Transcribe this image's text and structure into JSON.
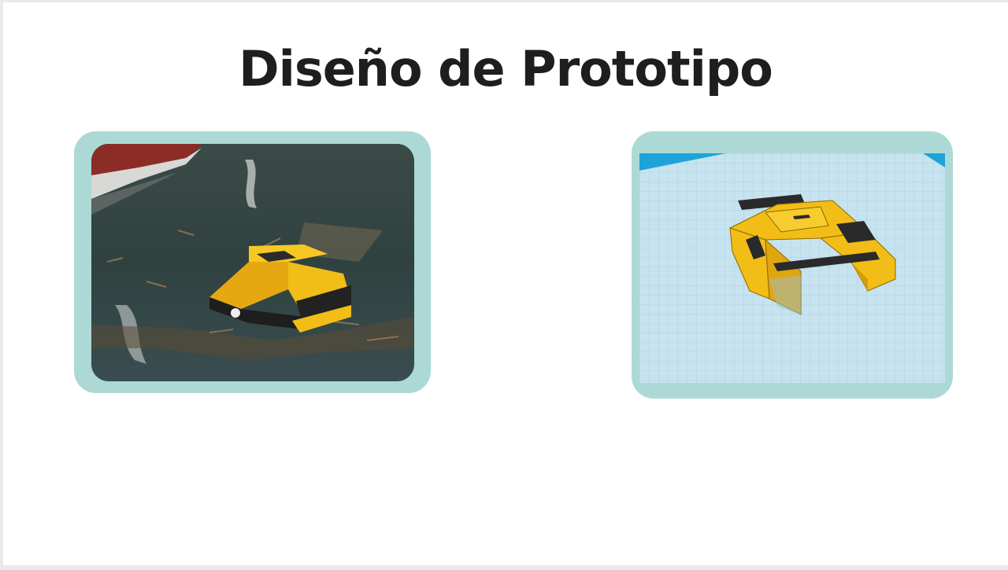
{
  "slide": {
    "title": "Diseño de Prototipo"
  },
  "images": [
    {
      "name": "prototype-photo",
      "depicts": "yellow catamaran robot floating in water collecting debris"
    },
    {
      "name": "prototype-3d-model",
      "depicts": "yellow catamaran 3D model on blue workplane grid"
    }
  ],
  "colors": {
    "frame": "#acd9d6",
    "title": "#1d1f1e",
    "robot_yellow": "#f2bd16",
    "workplane": "#c6e3ef"
  }
}
